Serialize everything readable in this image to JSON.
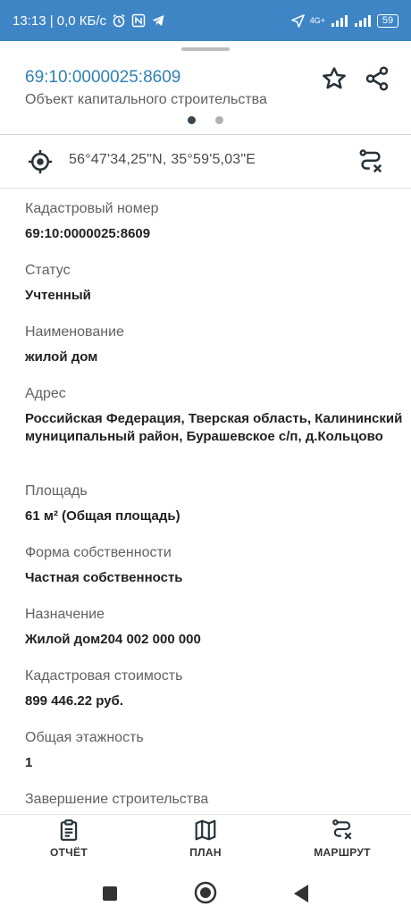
{
  "status_bar": {
    "time_speed": "13:13 | 0,0 КБ/с",
    "network": "4G+",
    "battery": "59"
  },
  "header": {
    "cadastral_link": "69:10:0000025:8609",
    "object_type": "Объект капитального строительства"
  },
  "coordinates": "56°47'34,25\"N, 35°59'5,03\"E",
  "fields": [
    {
      "label": "Кадастровый номер",
      "value": "69:10:0000025:8609"
    },
    {
      "label": "Статус",
      "value": "Учтенный"
    },
    {
      "label": "Наименование",
      "value": "жилой дом"
    },
    {
      "label": "Адрес",
      "value": "Российская Федерация, Тверская область, Калининский муниципальный район, Бурашевское с/п, д.Кольцово"
    },
    {
      "label": "Площадь",
      "value": "61 м² (Общая площадь)"
    },
    {
      "label": "Форма собственности",
      "value": "Частная собственность"
    },
    {
      "label": "Назначение",
      "value": "Жилой дом204 002 000 000"
    },
    {
      "label": "Кадастровая стоимость",
      "value": "899 446.22 руб."
    },
    {
      "label": "Общая этажность",
      "value": "1"
    },
    {
      "label": "Завершение строительства",
      "value": ""
    }
  ],
  "bottom_nav": {
    "report": "ОТЧЁТ",
    "plan": "ПЛАН",
    "route": "МАРШРУТ"
  },
  "colors": {
    "status_bar": "#3e85c6",
    "link": "#2f80b6"
  }
}
